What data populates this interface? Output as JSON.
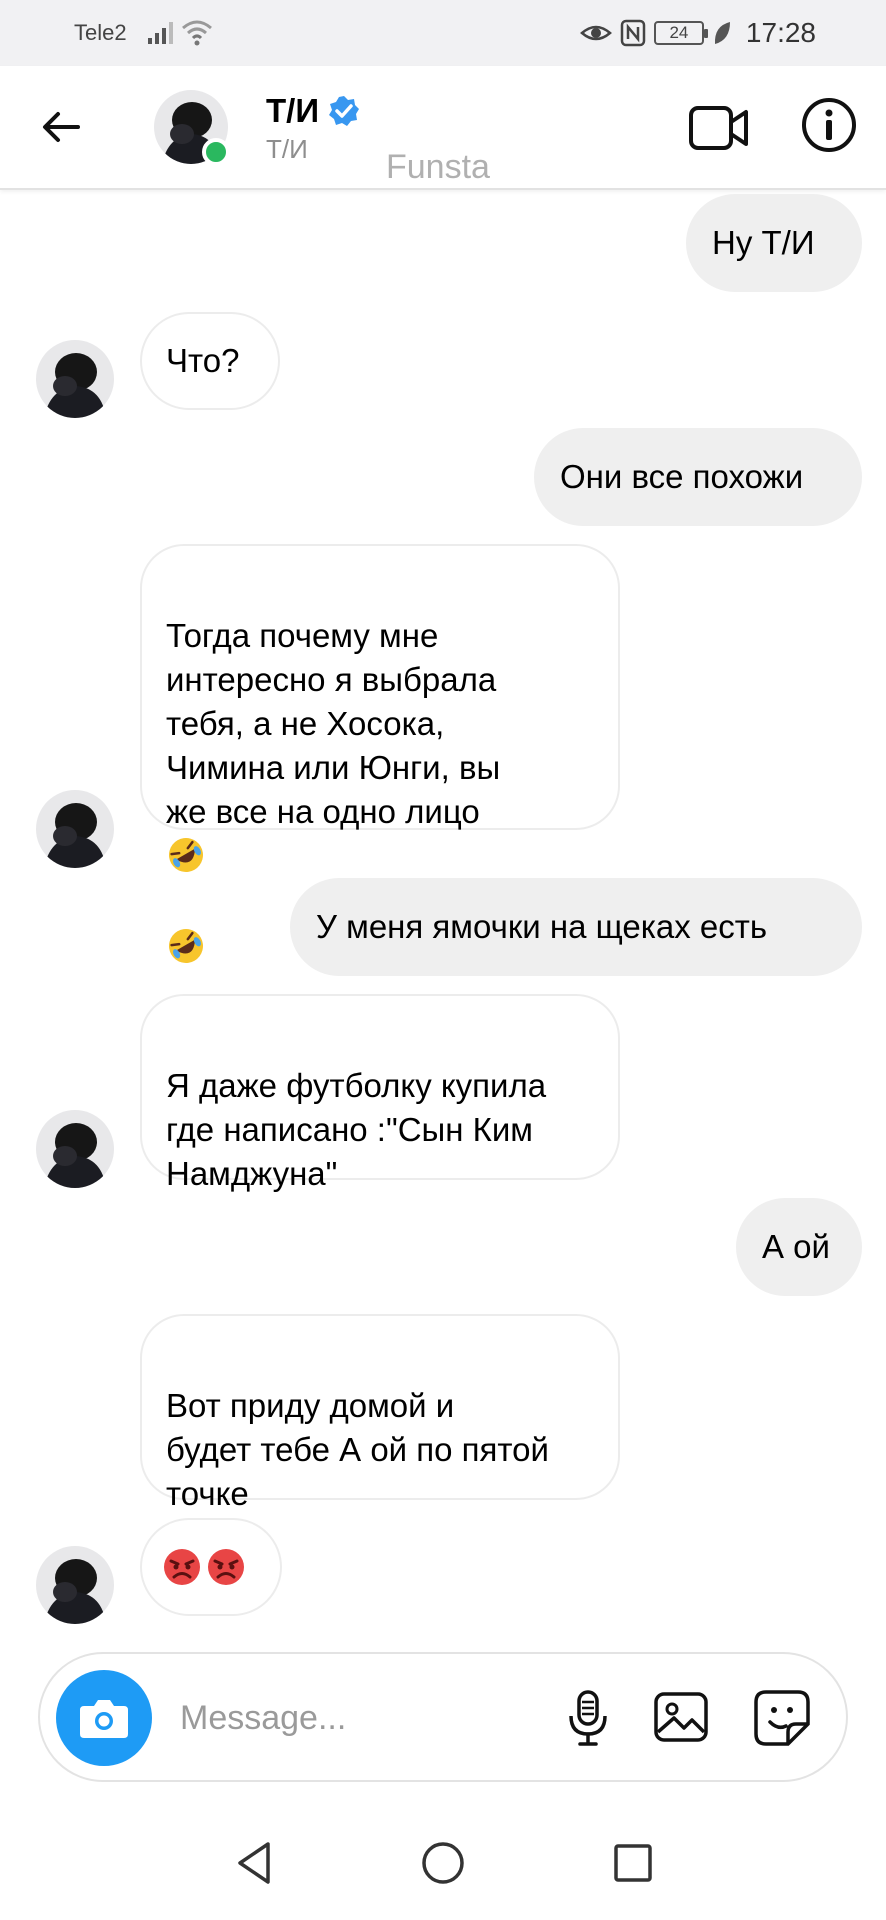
{
  "status_bar": {
    "carrier": "Tele2",
    "battery": "24",
    "time": "17:28"
  },
  "header": {
    "name": "Т/И",
    "username": "Т/И",
    "watermark": "Funsta"
  },
  "messages": [
    {
      "from": "me",
      "text": "Ну Т/И"
    },
    {
      "from": "them",
      "text": "Что?"
    },
    {
      "from": "me",
      "text": "Они все похожи"
    },
    {
      "from": "them",
      "text": "Тогда почему мне\nинтересно я выбрала\nтебя, а не Хосока,\nЧимина или Юнги, вы\nже все на одно лицо",
      "emoji": [
        "rolling-on-floor-laughing",
        "rolling-on-floor-laughing"
      ]
    },
    {
      "from": "me",
      "text": "У меня ямочки на щеках есть"
    },
    {
      "from": "them",
      "text": "Я даже футболку купила\nгде написано :\"Сын Ким\nНамджуна\""
    },
    {
      "from": "me",
      "text": "А ой"
    },
    {
      "from": "them",
      "text": "Вот приду домой и\nбудет тебе А ой по пятой\nточке"
    },
    {
      "from": "them",
      "emoji": [
        "pouting-face",
        "pouting-face"
      ]
    }
  ],
  "composer": {
    "placeholder": "Message..."
  },
  "colors": {
    "accent": "#1e9bf5",
    "online": "#2ab85f",
    "verified": "#3897f0",
    "outgoing_bubble": "#efefef"
  },
  "icons": [
    "back-arrow-icon",
    "verified-badge-icon",
    "video-call-icon",
    "info-icon",
    "camera-icon",
    "microphone-icon",
    "gallery-icon",
    "sticker-icon",
    "nav-back-icon",
    "nav-home-icon",
    "nav-recent-icon"
  ]
}
